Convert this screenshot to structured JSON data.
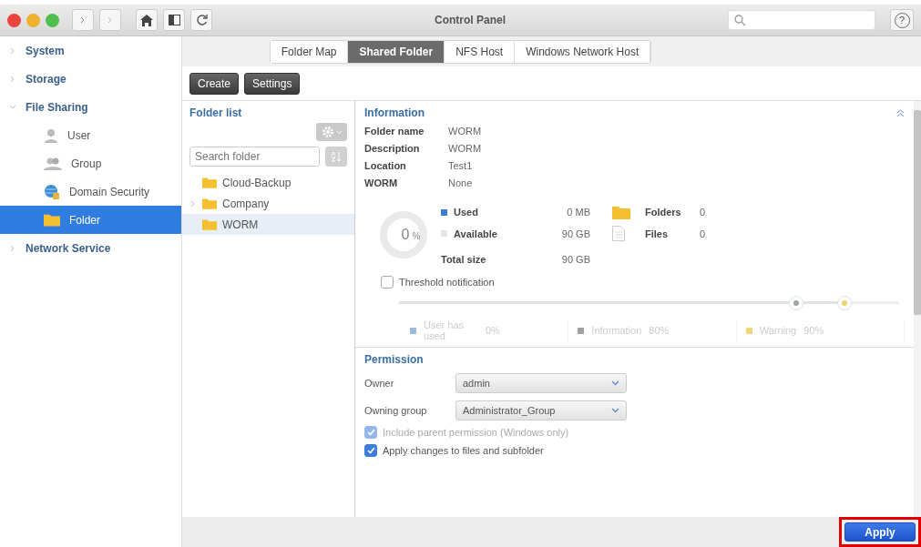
{
  "window": {
    "title": "Control Panel",
    "help": "?"
  },
  "sidebar": {
    "items": [
      {
        "label": "System",
        "expanded": false,
        "selected": false
      },
      {
        "label": "Storage",
        "expanded": false,
        "selected": false
      },
      {
        "label": "File Sharing",
        "expanded": true,
        "selected": false,
        "children": [
          {
            "label": "User",
            "selected": false
          },
          {
            "label": "Group",
            "selected": false
          },
          {
            "label": "Domain Security",
            "selected": false
          },
          {
            "label": "Folder",
            "selected": true
          }
        ]
      },
      {
        "label": "Network Service",
        "expanded": false,
        "selected": false
      }
    ]
  },
  "tabs": [
    {
      "label": "Folder Map",
      "selected": false
    },
    {
      "label": "Shared Folder",
      "selected": true
    },
    {
      "label": "NFS Host",
      "selected": false
    },
    {
      "label": "Windows Network Host",
      "selected": false
    }
  ],
  "toolbar": {
    "buttons": [
      "Create",
      "Settings"
    ]
  },
  "folder_list": {
    "title": "Folder list",
    "search": {
      "placeholder": "Search folder"
    },
    "items": [
      {
        "label": "Cloud-Backup",
        "has_children": false,
        "selected": false
      },
      {
        "label": "Company",
        "has_children": true,
        "selected": false
      },
      {
        "label": "WORM",
        "has_children": false,
        "selected": true
      }
    ]
  },
  "information": {
    "title": "Information",
    "fields": [
      {
        "label": "Folder name",
        "value": "WORM"
      },
      {
        "label": "Description",
        "value": "WORM"
      },
      {
        "label": "Location",
        "value": "Test1"
      },
      {
        "label": "WORM",
        "value": "None"
      }
    ],
    "usage": {
      "level": 0,
      "percent": "0",
      "unit": "%",
      "legend": [
        {
          "label": "Used",
          "value": "0 MB",
          "color": "#3b7dd8"
        },
        {
          "label": "Available",
          "value": "90 GB",
          "color": "#e4e4e4"
        },
        {
          "label": "Total size",
          "value": "90 GB"
        }
      ],
      "counts": [
        {
          "kind": "folder",
          "label": "Folders",
          "value": "0"
        },
        {
          "kind": "file",
          "label": "Files",
          "value": "0"
        }
      ]
    },
    "threshold": {
      "label": "Threshold notification",
      "checked": false,
      "thumbs": [
        {
          "level": 0.795,
          "color": "#9aa4a8"
        },
        {
          "level": 0.89,
          "color": "#e8d66a"
        }
      ],
      "items": [
        {
          "label": "User has used",
          "value": "0%",
          "color": "#9bbbe0"
        },
        {
          "label": "Information",
          "value": "80%",
          "color": "#a0a0a0"
        },
        {
          "label": "Warning",
          "value": "90%",
          "color": "#eed87a"
        }
      ]
    }
  },
  "permission": {
    "title": "Permission",
    "selects": [
      {
        "label": "Owner",
        "value": "admin"
      },
      {
        "label": "Owning group",
        "value": "Administrator_Group"
      }
    ],
    "checks": [
      {
        "label": "Include parent permission (Windows only)",
        "checked": true,
        "disabled": true
      },
      {
        "label": "Apply changes to files and subfolder",
        "checked": true,
        "disabled": false
      }
    ]
  },
  "footer": {
    "button": "Apply",
    "highlighted": true
  }
}
